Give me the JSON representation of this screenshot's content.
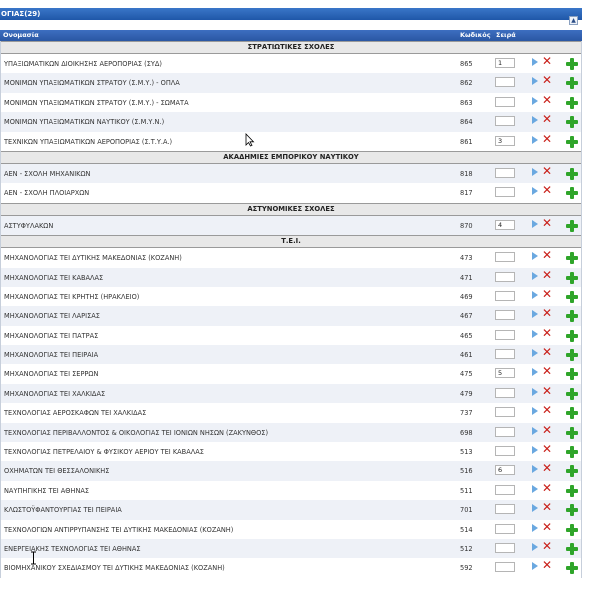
{
  "panel": {
    "title": "ΟΓΙΑΣ(29)",
    "collapse_icon": "chevron-up-icon"
  },
  "table": {
    "col_name": "Ονομασία",
    "col_code": "Κωδικός",
    "col_order": "Σειρά"
  },
  "groups": [
    {
      "title": "ΣΤΡΑΤΙΩΤΙΚΕΣ ΣΧΟΛΕΣ",
      "rows": [
        {
          "name": "ΥΠΑΞΙΩΜΑΤΙΚΩΝ ΔΙΟΙΚΗΣΗΣ ΑΕΡΟΠΟΡΙΑΣ (ΣΥΔ)",
          "code": "865",
          "order": "1"
        },
        {
          "name": "ΜΟΝΙΜΩΝ ΥΠΑΞΙΩΜΑΤΙΚΩΝ ΣΤΡΑΤΟΥ (Σ.Μ.Υ.) - ΟΠΛΑ",
          "code": "862",
          "order": ""
        },
        {
          "name": "ΜΟΝΙΜΩΝ ΥΠΑΞΙΩΜΑΤΙΚΩΝ ΣΤΡΑΤΟΥ (Σ.Μ.Υ.) - ΣΩΜΑΤΑ",
          "code": "863",
          "order": ""
        },
        {
          "name": "ΜΟΝΙΜΩΝ ΥΠΑΞΙΩΜΑΤΙΚΩΝ ΝΑΥΤΙΚΟΥ (Σ.Μ.Υ.Ν.)",
          "code": "864",
          "order": ""
        },
        {
          "name": "ΤΕΧΝΙΚΩΝ ΥΠΑΞΙΩΜΑΤΙΚΩΝ ΑΕΡΟΠΟΡΙΑΣ (Σ.Τ.Υ.Α.)",
          "code": "861",
          "order": "3"
        }
      ]
    },
    {
      "title": "ΑΚΑΔΗΜΙΕΣ ΕΜΠΟΡΙΚΟΥ ΝΑΥΤΙΚΟΥ",
      "rows": [
        {
          "name": "ΑΕΝ - ΣΧΟΛΗ ΜΗΧΑΝΙΚΩΝ",
          "code": "818",
          "order": ""
        },
        {
          "name": "ΑΕΝ - ΣΧΟΛΗ ΠΛΟΙΑΡΧΩΝ",
          "code": "817",
          "order": ""
        }
      ]
    },
    {
      "title": "ΑΣΤΥΝΟΜΙΚΕΣ ΣΧΟΛΕΣ",
      "rows": [
        {
          "name": "ΑΣΤΥΦΥΛΑΚΩΝ",
          "code": "870",
          "order": "4"
        }
      ]
    },
    {
      "title": "Τ.Ε.Ι.",
      "rows": [
        {
          "name": "ΜΗΧΑΝΟΛΟΓΙΑΣ ΤΕΙ ΔΥΤΙΚΗΣ ΜΑΚΕΔΟΝΙΑΣ (ΚΟΖΑΝΗ)",
          "code": "473",
          "order": ""
        },
        {
          "name": "ΜΗΧΑΝΟΛΟΓΙΑΣ ΤΕΙ ΚΑΒΑΛΑΣ",
          "code": "471",
          "order": ""
        },
        {
          "name": "ΜΗΧΑΝΟΛΟΓΙΑΣ ΤΕΙ ΚΡΗΤΗΣ (ΗΡΑΚΛΕΙΟ)",
          "code": "469",
          "order": ""
        },
        {
          "name": "ΜΗΧΑΝΟΛΟΓΙΑΣ ΤΕΙ ΛΑΡΙΣΑΣ",
          "code": "467",
          "order": ""
        },
        {
          "name": "ΜΗΧΑΝΟΛΟΓΙΑΣ ΤΕΙ ΠΑΤΡΑΣ",
          "code": "465",
          "order": ""
        },
        {
          "name": "ΜΗΧΑΝΟΛΟΓΙΑΣ ΤΕΙ ΠΕΙΡΑΙΑ",
          "code": "461",
          "order": ""
        },
        {
          "name": "ΜΗΧΑΝΟΛΟΓΙΑΣ ΤΕΙ ΣΕΡΡΩΝ",
          "code": "475",
          "order": "5"
        },
        {
          "name": "ΜΗΧΑΝΟΛΟΓΙΑΣ ΤΕΙ ΧΑΛΚΙΔΑΣ",
          "code": "479",
          "order": ""
        },
        {
          "name": "ΤΕΧΝΟΛΟΓΙΑΣ ΑΕΡΟΣΚΑΦΩΝ ΤΕΙ ΧΑΛΚΙΔΑΣ",
          "code": "737",
          "order": ""
        },
        {
          "name": "ΤΕΧΝΟΛΟΓΙΑΣ ΠΕΡΙΒΑΛΛΟΝΤΟΣ & ΟΙΚΟΛΟΓΙΑΣ ΤΕΙ ΙΟΝΙΩΝ ΝΗΣΩΝ (ΖΑΚΥΝΘΟΣ)",
          "code": "698",
          "order": ""
        },
        {
          "name": "ΤΕΧΝΟΛΟΓΙΑΣ ΠΕΤΡΕΛΑΙΟΥ & ΦΥΣΙΚΟΥ ΑΕΡΙΟΥ ΤΕΙ ΚΑΒΑΛΑΣ",
          "code": "513",
          "order": ""
        },
        {
          "name": "ΟΧΗΜΑΤΩΝ ΤΕΙ ΘΕΣΣΑΛΟΝΙΚΗΣ",
          "code": "516",
          "order": "6"
        },
        {
          "name": "ΝΑΥΠΗΓΙΚΗΣ ΤΕΙ ΑΘΗΝΑΣ",
          "code": "511",
          "order": ""
        },
        {
          "name": "ΚΛΩΣΤΟΫΦΑΝΤΟΥΡΓΙΑΣ ΤΕΙ ΠΕΙΡΑΙΑ",
          "code": "701",
          "order": ""
        },
        {
          "name": "ΤΕΧΝΟΛΟΓΙΩΝ ΑΝΤΙΡΡΥΠΑΝΣΗΣ ΤΕΙ ΔΥΤΙΚΗΣ ΜΑΚΕΔΟΝΙΑΣ (ΚΟΖΑΝΗ)",
          "code": "514",
          "order": ""
        },
        {
          "name": "ΕΝΕΡΓΕΙΑΚΗΣ ΤΕΧΝΟΛΟΓΙΑΣ ΤΕΙ ΑΘΗΝΑΣ",
          "code": "512",
          "order": ""
        },
        {
          "name": "ΒΙΟΜΗΧΑΝΙΚΟΥ ΣΧΕΔΙΑΣΜΟΥ ΤΕΙ ΔΥΤΙΚΗΣ ΜΑΚΕΔΟΝΙΑΣ (ΚΟΖΑΝΗ)",
          "code": "592",
          "order": ""
        }
      ]
    }
  ],
  "icons": {
    "edit": "play-arrow-icon",
    "delete": "delete-x-icon",
    "add": "plus-icon",
    "cursor": "mouse-pointer-icon",
    "text_cursor": "text-cursor-icon"
  },
  "colors": {
    "header_blue": "#2a57a3",
    "row_alt": "#eef1f7",
    "delete_red": "#c9201a",
    "add_green": "#2fa52a",
    "edit_blue": "#6aa8e0"
  }
}
